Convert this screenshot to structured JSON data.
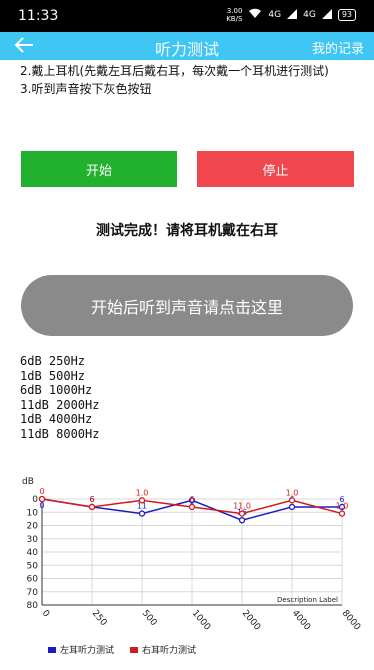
{
  "status_bar": {
    "time": "11:33",
    "net_speed": "3.00",
    "net_unit": "KB/S",
    "signal1": "4G",
    "signal2": "4G",
    "battery": "93"
  },
  "app_bar": {
    "back_icon": "arrow-left-icon",
    "title": "听力测试",
    "records_label": "我的记录"
  },
  "instructions": [
    "2.戴上耳机(先戴左耳后戴右耳，每次戴一个耳机进行测试)",
    "3.听到声音按下灰色按钮"
  ],
  "buttons": {
    "start": "开始",
    "stop": "停止",
    "listen": "开始后听到声音请点击这里"
  },
  "colors": {
    "app_bar": "#3fc6f4",
    "start": "#21b12f",
    "stop": "#f0464e",
    "listen": "#8a8a8a",
    "left_series": "#1a1ac8",
    "right_series": "#d41a1a"
  },
  "status_text": "测试完成！请将耳机戴在右耳",
  "results": [
    "6dB 250Hz",
    "1dB 500Hz",
    "6dB 1000Hz",
    "11dB 2000Hz",
    "1dB 4000Hz",
    "11dB 8000Hz"
  ],
  "chart_data": {
    "type": "line",
    "ylabel": "dB",
    "xlabel": "",
    "description_label": "Description Label",
    "ylim": [
      0,
      80
    ],
    "y_inverted": true,
    "y_ticks": [
      "0",
      "10",
      "20",
      "30",
      "40",
      "50",
      "60",
      "70",
      "80"
    ],
    "categories": [
      "0",
      "250",
      "500",
      "1000",
      "2000",
      "4000",
      "8000"
    ],
    "series": [
      {
        "name": "左耳听力测试",
        "color": "#1a1ac8",
        "values": [
          0,
          6,
          11,
          1,
          16,
          6,
          6
        ],
        "labels": [
          "0",
          "6",
          "11",
          "1",
          "16",
          "6",
          "6"
        ]
      },
      {
        "name": "右耳听力测试",
        "color": "#d41a1a",
        "values": [
          0,
          6,
          1,
          6,
          11,
          1,
          11
        ],
        "labels": [
          "0",
          "6",
          "1.0",
          "6",
          "11.0",
          "1.0",
          "1.0"
        ]
      }
    ],
    "grid": true,
    "legend_position": "bottom-left"
  }
}
